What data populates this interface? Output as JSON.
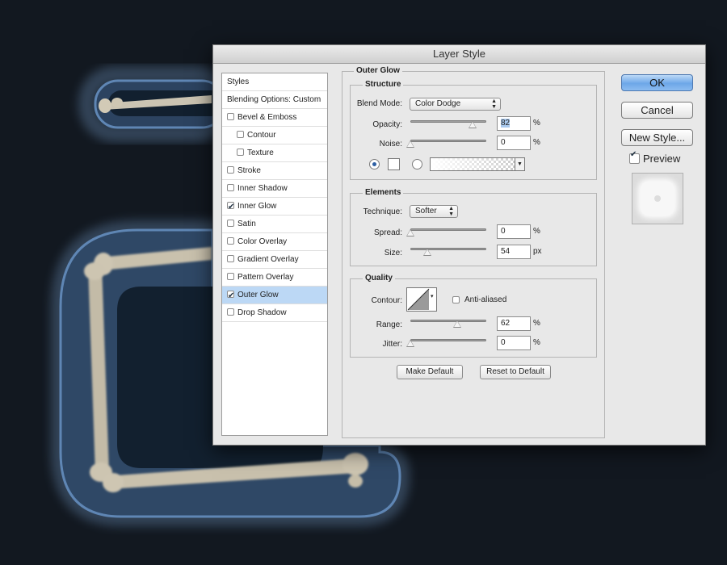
{
  "dialog": {
    "title": "Layer Style",
    "styles_list": {
      "header": "Styles",
      "blending": "Blending Options: Custom",
      "items": [
        {
          "label": "Bevel & Emboss",
          "checked": false,
          "indent": false,
          "selected": false
        },
        {
          "label": "Contour",
          "checked": false,
          "indent": true,
          "selected": false
        },
        {
          "label": "Texture",
          "checked": false,
          "indent": true,
          "selected": false
        },
        {
          "label": "Stroke",
          "checked": false,
          "indent": false,
          "selected": false
        },
        {
          "label": "Inner Shadow",
          "checked": false,
          "indent": false,
          "selected": false
        },
        {
          "label": "Inner Glow",
          "checked": true,
          "indent": false,
          "selected": false
        },
        {
          "label": "Satin",
          "checked": false,
          "indent": false,
          "selected": false
        },
        {
          "label": "Color Overlay",
          "checked": false,
          "indent": false,
          "selected": false
        },
        {
          "label": "Gradient Overlay",
          "checked": false,
          "indent": false,
          "selected": false
        },
        {
          "label": "Pattern Overlay",
          "checked": false,
          "indent": false,
          "selected": false
        },
        {
          "label": "Outer Glow",
          "checked": true,
          "indent": false,
          "selected": true
        },
        {
          "label": "Drop Shadow",
          "checked": false,
          "indent": false,
          "selected": false
        }
      ]
    },
    "outer_glow": {
      "title": "Outer Glow",
      "structure": {
        "title": "Structure",
        "blend_mode_label": "Blend Mode:",
        "blend_mode_value": "Color Dodge",
        "opacity_label": "Opacity:",
        "opacity_value": "82",
        "opacity_level": 0.82,
        "opacity_unit": "%",
        "noise_label": "Noise:",
        "noise_value": "0",
        "noise_level": 0,
        "noise_unit": "%"
      },
      "elements": {
        "title": "Elements",
        "technique_label": "Technique:",
        "technique_value": "Softer",
        "spread_label": "Spread:",
        "spread_value": "0",
        "spread_level": 0,
        "spread_unit": "%",
        "size_label": "Size:",
        "size_value": "54",
        "size_level": 0.22,
        "size_unit": "px"
      },
      "quality": {
        "title": "Quality",
        "contour_label": "Contour:",
        "anti_aliased_label": "Anti-aliased",
        "anti_aliased_checked": false,
        "range_label": "Range:",
        "range_value": "62",
        "range_level": 0.62,
        "range_unit": "%",
        "jitter_label": "Jitter:",
        "jitter_value": "0",
        "jitter_level": 0,
        "jitter_unit": "%"
      },
      "make_default": "Make Default",
      "reset_default": "Reset to Default"
    },
    "buttons": {
      "ok": "OK",
      "cancel": "Cancel",
      "new_style": "New Style...",
      "preview_label": "Preview",
      "preview_checked": true
    }
  },
  "colors": {
    "background": "#121820",
    "glow": "#4a6d95",
    "bone": "#c8c0ad",
    "selection": "#bcd8f5",
    "ok_button": "#6da7e8"
  }
}
